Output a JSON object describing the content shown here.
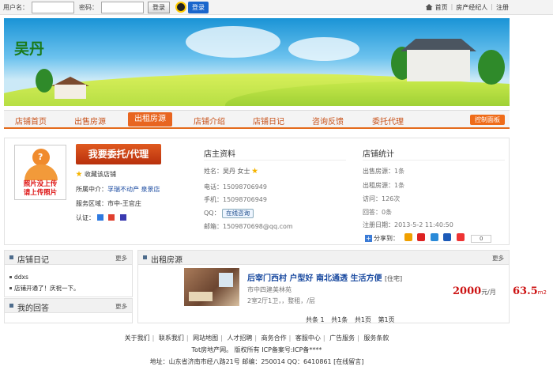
{
  "login": {
    "username_label": "用户名：",
    "password_label": "密码：",
    "login_button": "登录",
    "qq_login": "登录"
  },
  "toplinks": [
    "首页",
    "房产经纪人",
    "注册"
  ],
  "banner": {
    "shop_name": "吴丹"
  },
  "nav": {
    "items": [
      "店铺首页",
      "出售房源",
      "出租房源",
      "店铺介绍",
      "店铺日记",
      "咨询反馈",
      "委托代理"
    ],
    "active_index": 2,
    "control_panel": "控制面板"
  },
  "profile": {
    "avatar_text_1": "照片没上传",
    "avatar_text_2": "请上传照片",
    "cta": "我要委托/代理",
    "favorite": "收藏该店铺",
    "agency_label": "所属中介：",
    "agency_value": "孚瑞不动产  泉景店",
    "area_label": "服务区域：",
    "area_value": "市中-王官庄",
    "cert_label": "认证："
  },
  "owner": {
    "title": "店主资料",
    "name_label": "姓名：",
    "name_value": "吴丹  女士",
    "phone_label": "电话：",
    "phone_value": "15098706949",
    "mobile_label": "手机：",
    "mobile_value": "15098706949",
    "qq_label": "QQ：",
    "online": "在线咨询",
    "email_label": "邮箱：",
    "email_value": "1509870698@qq.com"
  },
  "stats": {
    "title": "店铺统计",
    "sale_label": "出售房源：",
    "sale_value": "1条",
    "rent_label": "出租房源：",
    "rent_value": "1条",
    "visit_label": "访问：",
    "visit_value": "126次",
    "reply_label": "回答：",
    "reply_value": "0条",
    "reg_label": "注册日期：",
    "reg_value": "2013-5-2  11:40:50",
    "share_label": "分享到：",
    "share_count": "0"
  },
  "diary": {
    "title": "店铺日记",
    "more": "更多",
    "items": [
      "ddxs",
      "店铺开通了！庆祝一下。"
    ]
  },
  "answers": {
    "title": "我的回答",
    "more": "更多"
  },
  "rent": {
    "title": "出租房源",
    "more": "更多",
    "listing": {
      "title": "后宰门西村  户型好  南北通透  生活方便",
      "tag": "[住宅]",
      "location": "市中四建美林苑",
      "detail": "2室2厅1卫，，整租，/层",
      "price": "2000",
      "price_unit": "元/月",
      "area": "63.5",
      "area_unit": "m2"
    },
    "pager": [
      "共条  1",
      "共1条",
      "共1页",
      "第1页"
    ]
  },
  "footer": {
    "links": [
      "关于我们",
      "联系我们",
      "网站地图",
      "人才招聘",
      "商务合作",
      "客服中心",
      "广告服务",
      "服务条款"
    ],
    "copyright": "Tot房地产网。 版权所有 ICP备案号:ICP备****",
    "address": "地址：山东省济南市经八路21号 邮编：250014 QQ：6410861 [在线留言]"
  }
}
